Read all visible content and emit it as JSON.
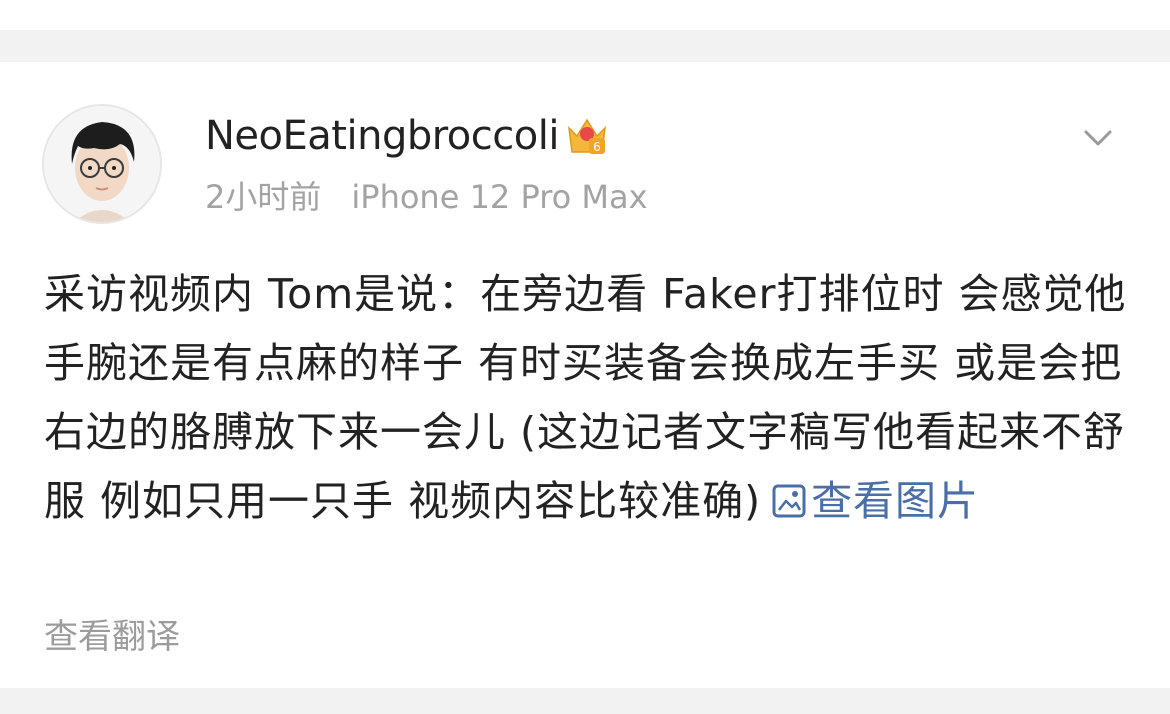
{
  "post": {
    "username": "NeoEatingbroccoli",
    "vip_badge_level": "6",
    "time_ago": "2小时前",
    "device": "iPhone 12 Pro Max",
    "text": "采访视频内 Tom是说：在旁边看 Faker打排位时 会感觉他手腕还是有点麻的样子 有时买装备会换成左手买 或是会把右边的胳膊放下来一会儿 (这边记者文字稿写他看起来不舒服 例如只用一只手 视频内容比较准确)",
    "view_image_label": "查看图片",
    "translate_label": "查看翻译"
  },
  "icons": {
    "avatar": "user-avatar-photo",
    "vip_badge": "crown-badge-icon",
    "more": "chevron-down-icon",
    "image": "image-icon"
  },
  "colors": {
    "link": "#4a6ea8",
    "meta": "#a3a3a3",
    "text": "#222222",
    "background": "#f2f2f2",
    "badge_gold": "#f3b73b"
  }
}
